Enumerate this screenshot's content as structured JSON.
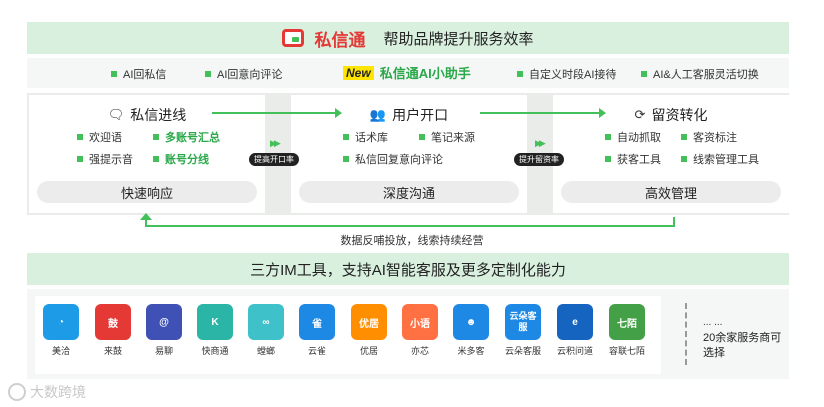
{
  "banner": {
    "brand_name": "私信通",
    "slogan": "帮助品牌提升服务效率"
  },
  "features": {
    "left_1": "AI回私信",
    "left_2": "AI回意向评论",
    "new_tag": "New",
    "assistant": "私信通AI小助手",
    "right_1": "自定义时段AI接待",
    "right_2": "AI&人工客服灵活切换"
  },
  "panels": [
    {
      "title": "私信进线",
      "icon": "chat-window-icon",
      "items": [
        "欢迎语",
        "多账号汇总",
        "强提示音",
        "账号分线"
      ],
      "highlight": [
        false,
        true,
        false,
        true
      ],
      "footer": "快速响应"
    },
    {
      "title": "用户开口",
      "icon": "user-group-icon",
      "items": [
        "话术库",
        "笔记来源",
        "私信回复意向评论"
      ],
      "highlight": [
        false,
        false,
        false
      ],
      "footer": "深度沟通"
    },
    {
      "title": "留资转化",
      "icon": "refresh-icon",
      "items": [
        "自动抓取",
        "客资标注",
        "获客工具",
        "线索管理工具"
      ],
      "highlight": [
        false,
        false,
        false,
        false
      ],
      "footer": "高效管理"
    }
  ],
  "chips": {
    "first": "提高开口率",
    "second": "提升留资率"
  },
  "feedback_text": "数据反哺投放，线索持续经营",
  "im_banner": "三方IM工具，支持AI智能客服及更多定制化能力",
  "apps": [
    {
      "name": "美洽",
      "glyph": "◔",
      "color": "#1e9be6"
    },
    {
      "name": "来鼓",
      "glyph": "鼓",
      "color": "#e53935"
    },
    {
      "name": "易聊",
      "glyph": "@",
      "color": "#3f51b5"
    },
    {
      "name": "快商通",
      "glyph": "K",
      "color": "#2bb5a6"
    },
    {
      "name": "螳螂",
      "glyph": "∞",
      "color": "#3fc1c9"
    },
    {
      "name": "云雀",
      "glyph": "雀",
      "color": "#1e88e5"
    },
    {
      "name": "优居",
      "glyph": "优居",
      "color": "#ff8f00"
    },
    {
      "name": "亦芯",
      "glyph": "小语",
      "color": "#ff7043"
    },
    {
      "name": "米多客",
      "glyph": "☻",
      "color": "#1e88e5"
    },
    {
      "name": "云朵客服",
      "glyph": "云朵客服",
      "color": "#1e88e5"
    },
    {
      "name": "云积问道",
      "glyph": "e",
      "color": "#1565c0"
    },
    {
      "name": "容联七陌",
      "glyph": "七陌",
      "color": "#43a047"
    }
  ],
  "more": {
    "dots": "... ...",
    "text": "20余家服务商可选择"
  },
  "watermark": "大数跨境"
}
